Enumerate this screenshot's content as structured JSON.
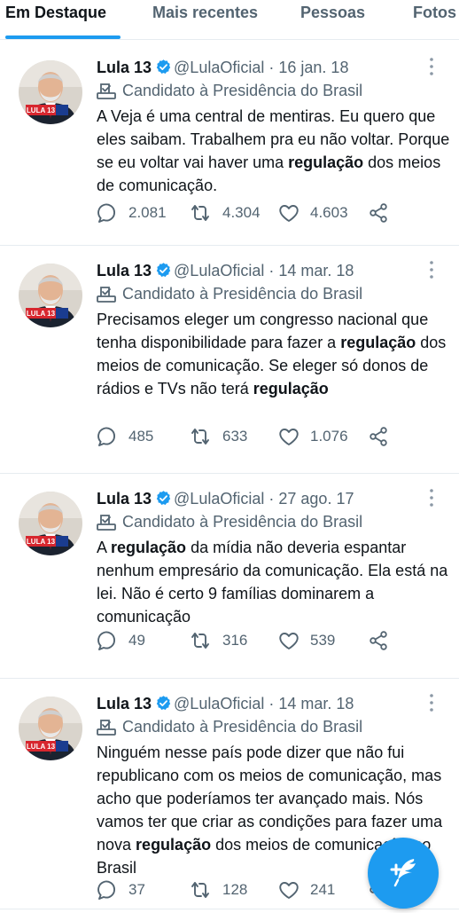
{
  "tabs": [
    {
      "label": "Em Destaque",
      "active": true
    },
    {
      "label": "Mais recentes",
      "active": false
    },
    {
      "label": "Pessoas",
      "active": false
    },
    {
      "label": "Fotos",
      "active": false
    }
  ],
  "colors": {
    "accent": "#1d9bf0",
    "secondary_text": "#536471",
    "primary_text": "#0f1419"
  },
  "tweets": [
    {
      "name": "Lula 13",
      "handle": "@LulaOficial",
      "sep": "·",
      "date": "16 jan. 18",
      "label": "Candidato à Presidência do Brasil",
      "segments": [
        {
          "text": "A Veja é uma central de mentiras. Eu quero que eles saibam. Trabalhem pra eu não voltar. Porque se eu voltar vai haver uma ",
          "bold": false
        },
        {
          "text": "regulação",
          "bold": true
        },
        {
          "text": " dos meios de comunicação.",
          "bold": false
        }
      ],
      "replies": "2.081",
      "retweets": "4.304",
      "likes": "4.603"
    },
    {
      "name": "Lula 13",
      "handle": "@LulaOficial",
      "sep": "·",
      "date": "14 mar. 18",
      "label": "Candidato à Presidência do Brasil",
      "segments": [
        {
          "text": "Precisamos eleger um congresso nacional que tenha disponibilidade para fazer a ",
          "bold": false
        },
        {
          "text": "regulação",
          "bold": true
        },
        {
          "text": " dos meios de comunicação. Se eleger só donos de rádios e TVs não terá ",
          "bold": false
        },
        {
          "text": "regulação",
          "bold": true
        }
      ],
      "replies": "485",
      "retweets": "633",
      "likes": "1.076"
    },
    {
      "name": "Lula 13",
      "handle": "@LulaOficial",
      "sep": "·",
      "date": "27 ago. 17",
      "label": "Candidato à Presidência do Brasil",
      "segments": [
        {
          "text": "A ",
          "bold": false
        },
        {
          "text": "regulação",
          "bold": true
        },
        {
          "text": " da mídia não deveria espantar nenhum empresário da comunicação. Ela está na lei. Não é certo 9 famílias dominarem a comunicação",
          "bold": false
        }
      ],
      "replies": "49",
      "retweets": "316",
      "likes": "539"
    },
    {
      "name": "Lula 13",
      "handle": "@LulaOficial",
      "sep": "·",
      "date": "14 mar. 18",
      "label": "Candidato à Presidência do Brasil",
      "segments": [
        {
          "text": "Ninguém nesse país pode dizer que não fui republicano com os meios de comunicação, mas acho que poderíamos ter avançado mais. Nós vamos ter que criar as condições para fazer uma nova ",
          "bold": false
        },
        {
          "text": "regulação",
          "bold": true
        },
        {
          "text": " dos meios de comunicação no Brasil",
          "bold": false
        }
      ],
      "replies": "37",
      "retweets": "128",
      "likes": "241"
    }
  ],
  "avatar_badge": "LULA 13",
  "fab": {
    "icon": "compose-plus-feather-icon"
  }
}
